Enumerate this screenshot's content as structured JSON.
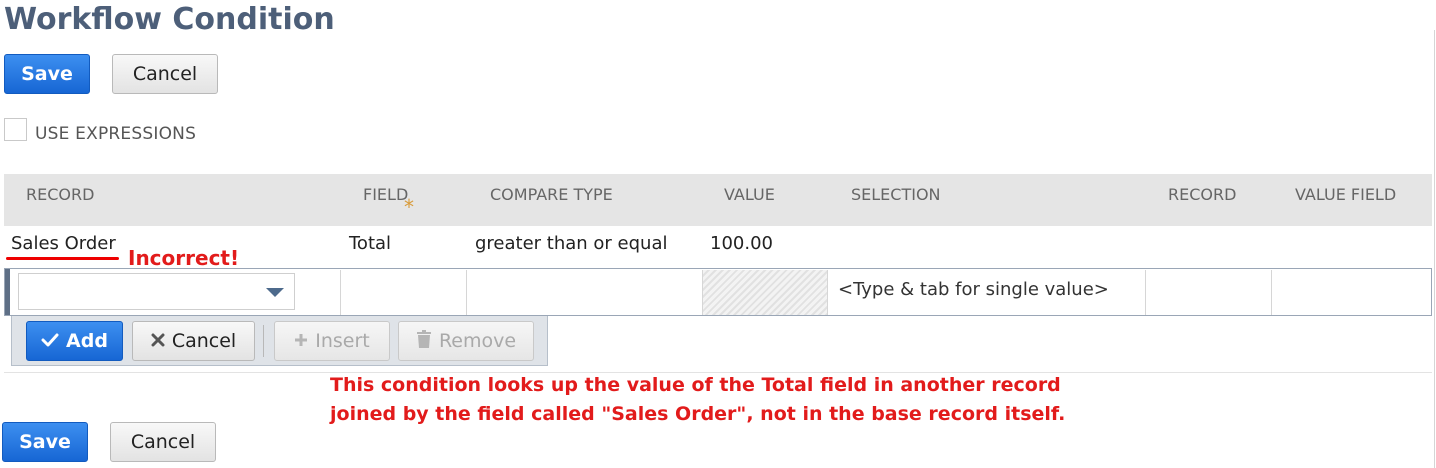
{
  "page": {
    "title": "Workflow Condition"
  },
  "actions": {
    "save_label": "Save",
    "cancel_label": "Cancel"
  },
  "options": {
    "use_expressions_label": "USE EXPRESSIONS",
    "use_expressions_checked": false
  },
  "table": {
    "headers": [
      "RECORD",
      "FIELD",
      "COMPARE TYPE",
      "VALUE",
      "SELECTION",
      "RECORD",
      "VALUE FIELD"
    ],
    "required_marker": "*",
    "rows": [
      {
        "record": "Sales Order",
        "field": "Total",
        "compare_type": "greater than or equal",
        "value": "100.00",
        "selection": "",
        "record2": "",
        "value_field": ""
      }
    ],
    "edit_row": {
      "record_value": "",
      "selection_placeholder": "<Type & tab for single value>"
    }
  },
  "row_toolbar": {
    "add_label": "Add",
    "cancel_label": "Cancel",
    "insert_label": "Insert",
    "remove_label": "Remove"
  },
  "annotations": {
    "incorrect_label": "Incorrect!",
    "note_line1": "This condition looks up the value of the Total field in another record",
    "note_line2": "joined by the field called \"Sales Order\", not in the base record itself.",
    "accent_color": "#e21b1b"
  },
  "colors": {
    "primary_button": "#1f74e0",
    "title": "#4d5f79",
    "required_star": "#d89b3a"
  },
  "icons": {
    "add": "check-icon",
    "cancel": "x-icon",
    "insert": "plus-icon",
    "remove": "trash-icon",
    "dropdown": "chevron-down-icon"
  }
}
